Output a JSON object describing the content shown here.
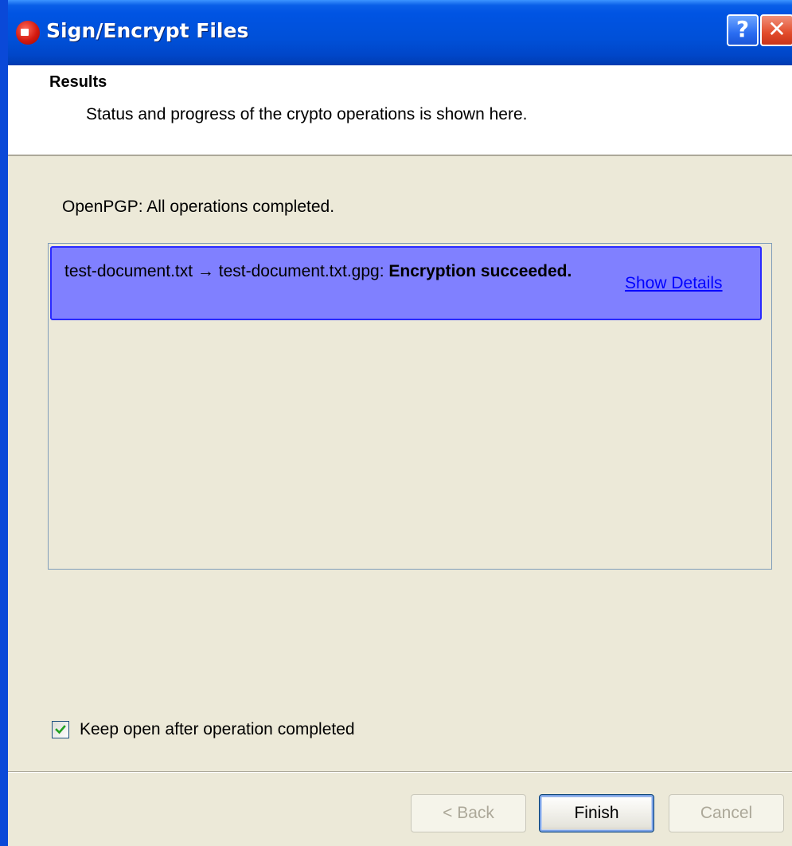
{
  "window": {
    "title": "Sign/Encrypt Files",
    "help_button": "?",
    "close_button": "✕"
  },
  "header": {
    "title": "Results",
    "subtitle": "Status and progress of the crypto operations is shown here."
  },
  "status": {
    "message": "OpenPGP: All operations completed."
  },
  "results": [
    {
      "source": "test-document.txt",
      "arrow": "→",
      "target": "test-document.txt.gpg:",
      "result": "Encryption succeeded.",
      "details_link": "Show Details"
    }
  ],
  "options": {
    "keep_open_label": "Keep open after operation completed",
    "keep_open_checked": true
  },
  "buttons": {
    "back": "< Back",
    "finish": "Finish",
    "cancel": "Cancel"
  },
  "colors": {
    "titlebar": "#0054e3",
    "result_highlight": "#8080ff",
    "link": "#0000ff",
    "dialog_bg": "#ece9d8"
  }
}
